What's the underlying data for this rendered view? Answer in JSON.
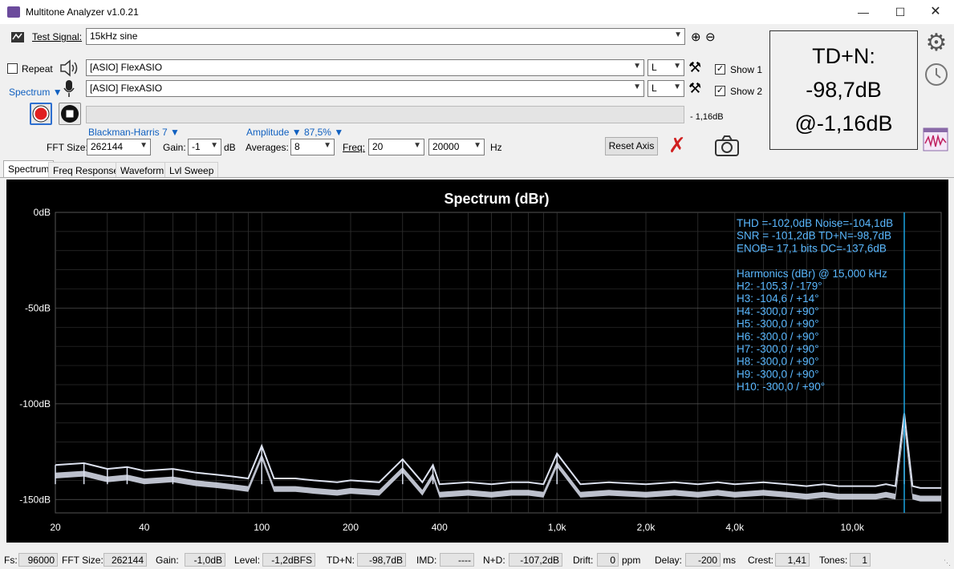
{
  "window": {
    "title": "Multitone Analyzer v1.0.21"
  },
  "toolbar": {
    "test_signal_label": "Test Signal:",
    "test_signal_value": "15kHz sine",
    "repeat_label": "Repeat",
    "output_device": "[ASIO] FlexASIO",
    "output_channel": "L",
    "show1_label": "Show 1",
    "spectrum_mode": "Spectrum",
    "input_device": "[ASIO] FlexASIO",
    "input_channel": "L",
    "show2_label": "Show 2",
    "level_readout": "- 1,16dB",
    "window_func": "Blackman-Harris 7",
    "amplitude_label": "Amplitude",
    "overlap": "87,5%",
    "fft_size_label": "FFT Size:",
    "fft_size": "262144",
    "gain_label": "Gain:",
    "gain": "-1",
    "gain_unit": "dB",
    "averages_label": "Averages:",
    "averages": "8",
    "freq_label": "Freq:",
    "freq_from": "20",
    "freq_to": "20000",
    "freq_unit": "Hz",
    "reset_axis": "Reset Axis"
  },
  "summary": {
    "line1": "TD+N:",
    "line2": "-98,7dB",
    "line3": "@-1,16dB"
  },
  "tabs": [
    "Spectrum",
    "Freq Response",
    "Waveform",
    "Lvl Sweep"
  ],
  "chart_data": {
    "type": "line",
    "title": "Spectrum (dBr)",
    "x_scale": "log",
    "xlim": [
      20,
      20000
    ],
    "ylim": [
      -157,
      0
    ],
    "x_ticks": [
      20,
      40,
      100,
      200,
      400,
      1000,
      2000,
      4000,
      10000
    ],
    "x_tick_labels": [
      "20",
      "40",
      "100",
      "200",
      "400",
      "1,0k",
      "2,0k",
      "4,0k",
      "10,0k"
    ],
    "y_ticks": [
      0,
      -50,
      -100,
      -150
    ],
    "y_tick_labels": [
      "0dB",
      "-50dB",
      "-100dB",
      "-150dB"
    ],
    "grid": true,
    "series": [
      {
        "color": "#dde2f0",
        "x": [
          20,
          25,
          30,
          35,
          40,
          50,
          60,
          70,
          80,
          90,
          100,
          110,
          130,
          150,
          180,
          200,
          250,
          300,
          350,
          380,
          400,
          500,
          600,
          700,
          800,
          900,
          1000,
          1200,
          1500,
          2000,
          2500,
          3000,
          3500,
          4000,
          5000,
          6000,
          7000,
          8000,
          9000,
          10000,
          11000,
          12000,
          13000,
          14000,
          15000,
          16000,
          17000,
          18000,
          19000,
          20000
        ],
        "y": [
          -132,
          -131,
          -134,
          -133,
          -135,
          -134,
          -136,
          -137,
          -138,
          -139,
          -122,
          -139,
          -139,
          -140,
          -141,
          -140,
          -141,
          -129,
          -141,
          -132,
          -142,
          -141,
          -142,
          -141,
          -141,
          -142,
          -126,
          -142,
          -141,
          -142,
          -141,
          -142,
          -141,
          -142,
          -141,
          -142,
          -143,
          -142,
          -143,
          -143,
          -143,
          -143,
          -142,
          -143,
          -105,
          -143,
          -144,
          -144,
          -144,
          -144
        ]
      },
      {
        "color": "#1aa3e0",
        "x": [
          15000,
          15000
        ],
        "y": [
          0,
          -157
        ]
      }
    ],
    "annotations": [
      "THD =-102,0dB   Noise=-104,1dB",
      "SNR = -101,2dB  TD+N=-98,7dB",
      "ENOB= 17,1 bits  DC=-137,6dB",
      "",
      "Harmonics (dBr) @ 15,000 kHz",
      "H2: -105,3  / -179°",
      "H3: -104,6  / +14°",
      "H4: -300,0  / +90°",
      "H5: -300,0  / +90°",
      "H6: -300,0  / +90°",
      "H7: -300,0  / +90°",
      "H8: -300,0  / +90°",
      "H9: -300,0  / +90°",
      "H10: -300,0  / +90°"
    ]
  },
  "status": {
    "fs_label": "Fs:",
    "fs": "96000",
    "fft_label": "FFT Size:",
    "fft": "262144",
    "gain_label": "Gain:",
    "gain": "-1,0dB",
    "level_label": "Level:",
    "level": "-1,2dBFS",
    "tdn_label": "TD+N:",
    "tdn": "-98,7dB",
    "imd_label": "IMD:",
    "imd": "----",
    "nd_label": "N+D:",
    "nd": "-107,2dB",
    "drift_label": "Drift:",
    "drift": "0",
    "drift_unit": "ppm",
    "delay_label": "Delay:",
    "delay": "-200",
    "delay_unit": "ms",
    "crest_label": "Crest:",
    "crest": "1,41",
    "tones_label": "Tones:",
    "tones": "1"
  }
}
